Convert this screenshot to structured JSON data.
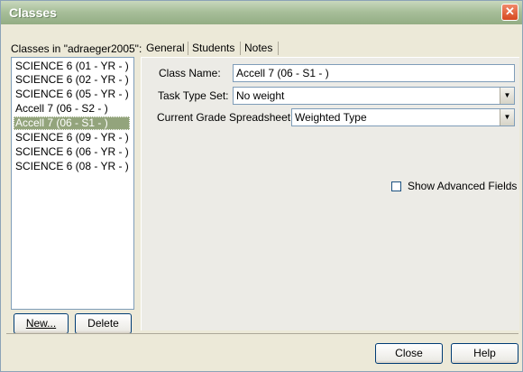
{
  "window": {
    "title": "Classes",
    "close_glyph": "✕"
  },
  "classes_panel": {
    "heading": "Classes in \"adraeger2005\":",
    "items": [
      "SCIENCE 6 (01 - YR - )",
      "SCIENCE 6 (02 - YR - )",
      "SCIENCE 6 (05 - YR - )",
      "Accell 7 (06 - S2 - )",
      "Accell 7 (06 - S1 - )",
      "SCIENCE 6 (09 - YR - )",
      "SCIENCE 6 (06 - YR - )",
      "SCIENCE 6 (08 - YR - )"
    ],
    "selected_index": 4,
    "new_button": "New...",
    "delete_button": "Delete"
  },
  "tabs": [
    "General",
    "Students",
    "Notes"
  ],
  "active_tab": "General",
  "general": {
    "class_name_label": "Class Name:",
    "class_name_value": "Accell 7 (06 - S1 - )",
    "task_type_label": "Task Type Set:",
    "task_type_value": "No weight",
    "spreadsheet_label": "Current Grade Spreadsheet:",
    "spreadsheet_value": "Weighted Type",
    "show_advanced_label": "Show Advanced Fields",
    "show_advanced_checked": false
  },
  "footer": {
    "close_button": "Close",
    "help_button": "Help"
  },
  "icons": {
    "dropdown": "chevron-down-icon",
    "close": "close-icon"
  }
}
